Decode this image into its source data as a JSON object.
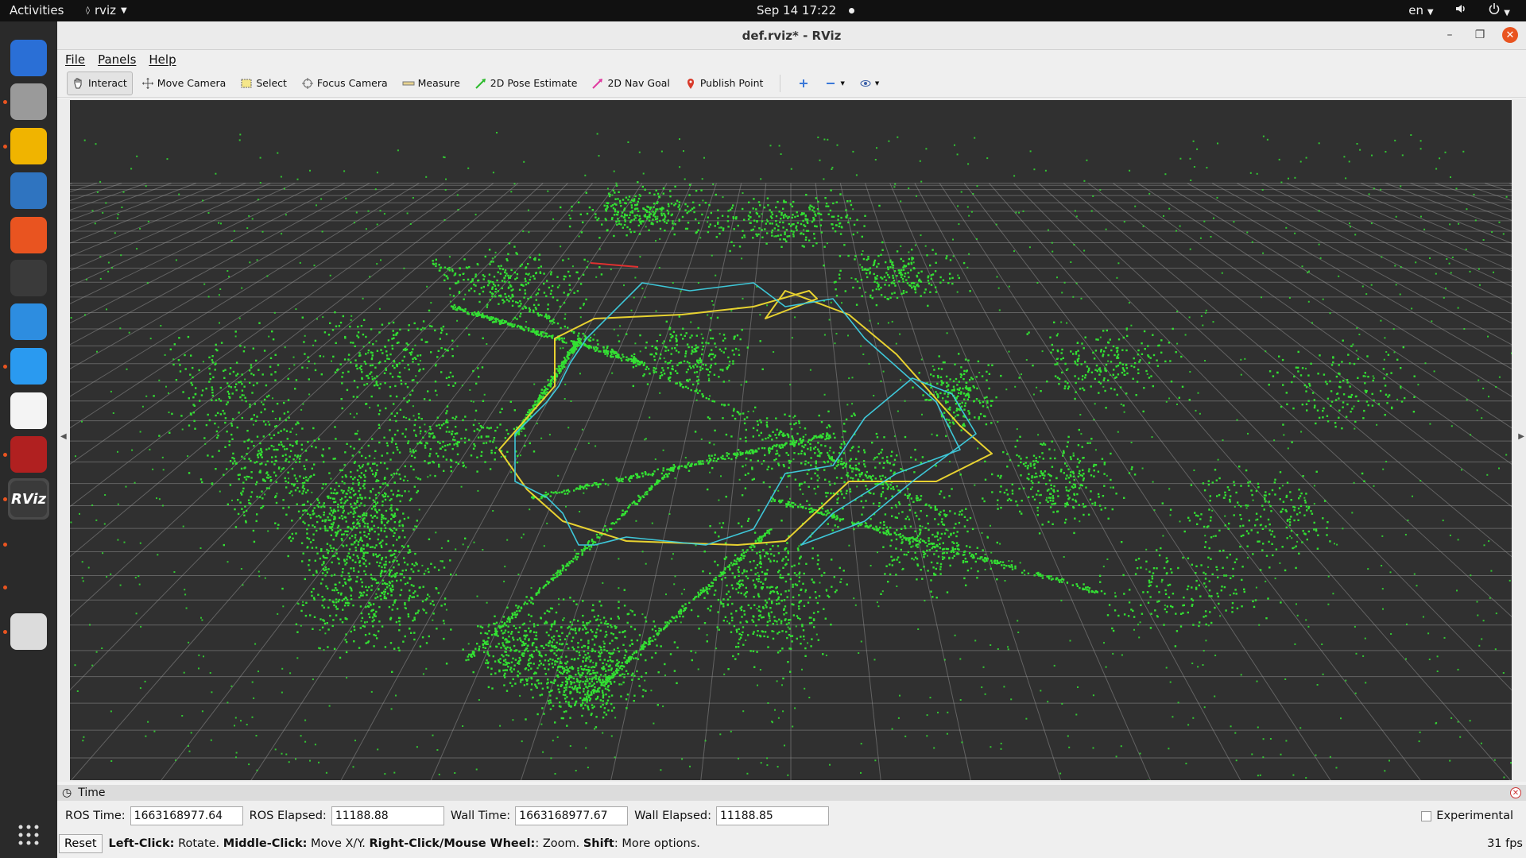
{
  "topbar": {
    "activities": "Activities",
    "app_name": "rviz",
    "datetime": "Sep 14  17:22",
    "language": "en"
  },
  "dock": {
    "items": [
      {
        "name": "thunderbird",
        "color": "#2a6fd6"
      },
      {
        "name": "files",
        "color": "#9a9a9a"
      },
      {
        "name": "rhythmbox",
        "color": "#f0b400"
      },
      {
        "name": "libreoffice-writer",
        "color": "#2f74c0"
      },
      {
        "name": "ubuntu-software",
        "color": "#e95420"
      },
      {
        "name": "terminal",
        "color": "#3a3a3a"
      },
      {
        "name": "help",
        "color": "#2d8de0"
      },
      {
        "name": "vscode",
        "color": "#2a9af0"
      },
      {
        "name": "text-editor",
        "color": "#f4f4f4"
      },
      {
        "name": "system-monitor",
        "color": "#b02020"
      },
      {
        "name": "rviz",
        "color": "#3a3a3a",
        "label": "RViz"
      },
      {
        "name": "search",
        "color": "#dcdcdc"
      }
    ]
  },
  "window": {
    "title": "def.rviz* - RViz"
  },
  "menu": {
    "file": "File",
    "panels": "Panels",
    "help": "Help"
  },
  "toolbar": {
    "interact": "Interact",
    "move_camera": "Move Camera",
    "select": "Select",
    "focus_camera": "Focus Camera",
    "measure": "Measure",
    "pose_estimate": "2D Pose Estimate",
    "nav_goal": "2D Nav Goal",
    "publish_point": "Publish Point"
  },
  "colors": {
    "pointcloud": "#33e033",
    "path_yellow": "#e8d230",
    "path_cyan": "#3ec7d8",
    "grid": "#a0a0a0",
    "background": "#303030"
  },
  "time_panel": {
    "title": "Time",
    "ros_time_label": "ROS Time:",
    "ros_time": "1663168977.64",
    "ros_elapsed_label": "ROS Elapsed:",
    "ros_elapsed": "11188.88",
    "wall_time_label": "Wall Time:",
    "wall_time": "1663168977.67",
    "wall_elapsed_label": "Wall Elapsed:",
    "wall_elapsed": "11188.85",
    "experimental": "Experimental"
  },
  "status": {
    "reset": "Reset",
    "left_click": "Left-Click:",
    "left_click_text": " Rotate. ",
    "middle_click": "Middle-Click:",
    "middle_click_text": " Move X/Y. ",
    "right_click": "Right-Click/Mouse Wheel:",
    "right_click_text": ": Zoom. ",
    "shift": "Shift",
    "shift_text": ": More options.",
    "fps": "31 fps"
  }
}
